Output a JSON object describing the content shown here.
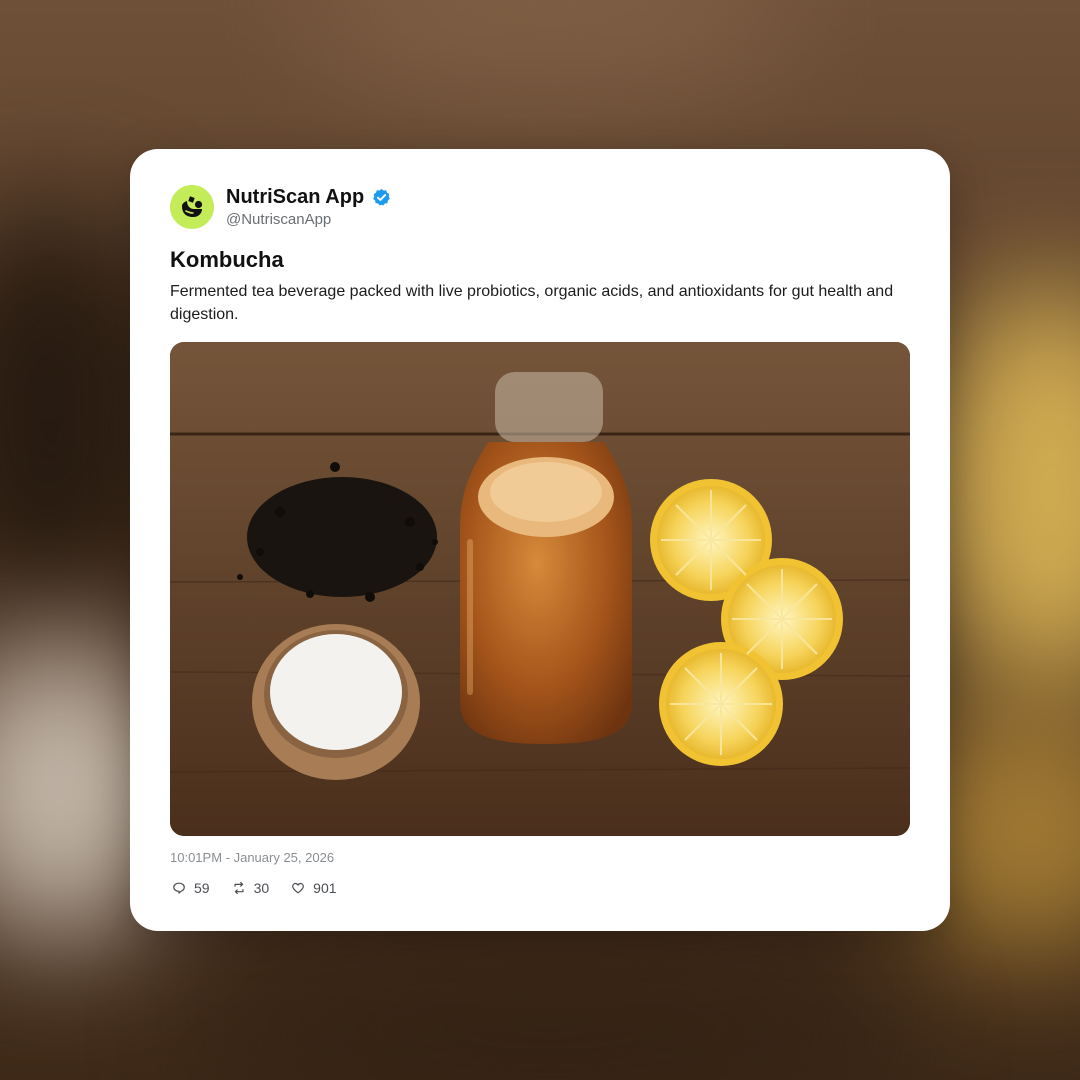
{
  "post": {
    "author_name": "NutriScan App",
    "author_handle": "@NutriscanApp",
    "avatar_icon": "leaf-logo-icon",
    "verified_icon": "verified-badge-icon",
    "title": "Kombucha",
    "description": "Fermented tea beverage packed with live probiotics, organic acids, and antioxidants for gut health and digestion.",
    "image_subject": "kombucha-ingredients-photo",
    "timestamp": "10:01PM - January 25, 2026",
    "stats": {
      "replies": "59",
      "reposts": "30",
      "likes": "901"
    }
  },
  "colors": {
    "avatar_bg": "#c3ec58",
    "verified_blue": "#1d9bf0",
    "card_bg": "#ffffff"
  }
}
